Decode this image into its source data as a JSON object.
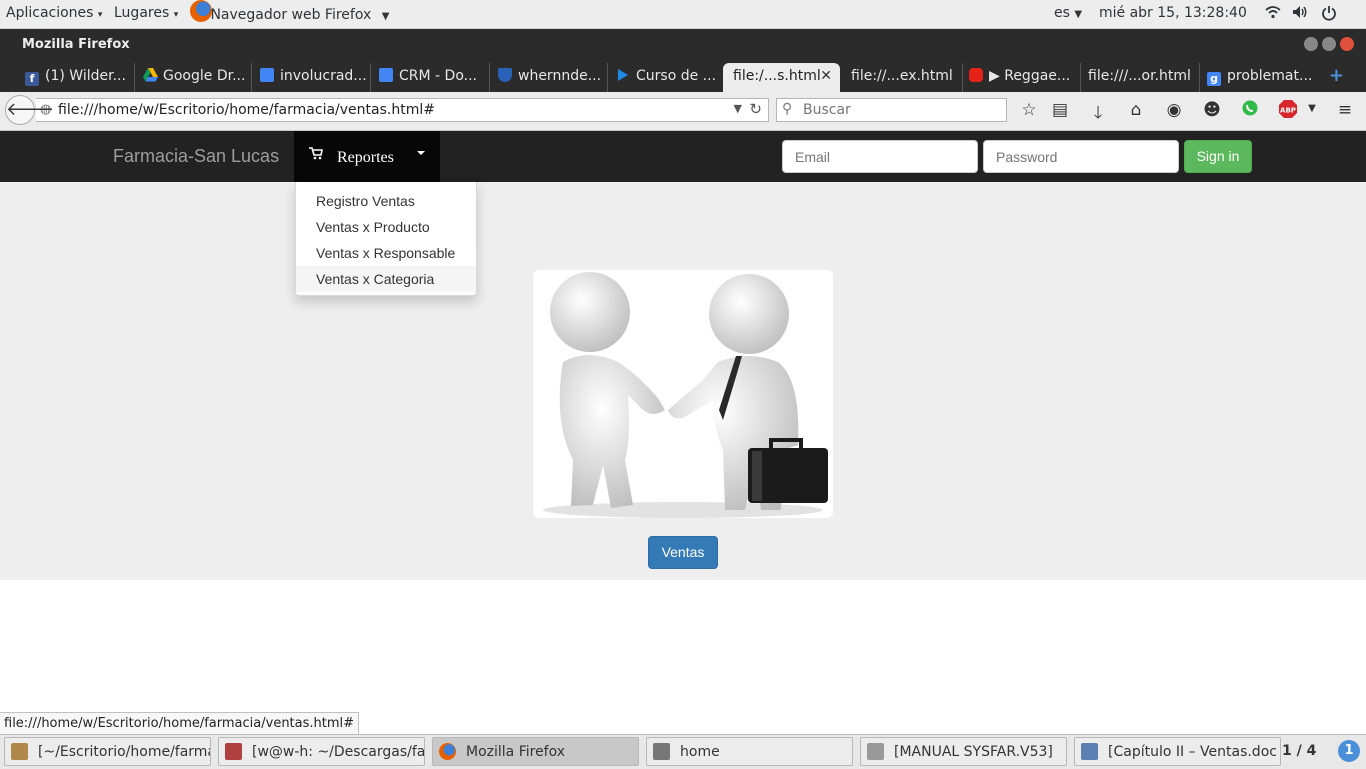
{
  "top_panel": {
    "apps_menu": "Aplicaciones",
    "places_menu": "Lugares",
    "active_app": "Navegador web Firefox",
    "language": "es",
    "clock": "mié abr 15, 13:28:40"
  },
  "window": {
    "title": "Mozilla Firefox"
  },
  "tabs": [
    {
      "label": "(1) Wilder...",
      "icon": "facebook-icon",
      "color": "#3b5998"
    },
    {
      "label": "Google Dr...",
      "icon": "google-drive-icon",
      "color": "#f4b400"
    },
    {
      "label": "involucrad...",
      "icon": "google-docs-icon",
      "color": "#4285f4"
    },
    {
      "label": "CRM - Do...",
      "icon": "google-docs-icon",
      "color": "#4285f4"
    },
    {
      "label": "whernnde...",
      "icon": "shield-icon",
      "color": "#2a62b8"
    },
    {
      "label": "Curso de ...",
      "icon": "bookmark-icon",
      "color": "#1e88e5"
    },
    {
      "label": "file:/...s.html",
      "icon": "none",
      "active": true
    },
    {
      "label": "file://...ex.html",
      "icon": "none"
    },
    {
      "label": "▶ Reggae...",
      "icon": "youtube-icon",
      "color": "#e62117"
    },
    {
      "label": "file:///...or.html",
      "icon": "none"
    },
    {
      "label": "problemat...",
      "icon": "google-icon",
      "color": "#4285f4"
    }
  ],
  "navbar": {
    "url": "file:///home/w/Escritorio/home/farmacia/ventas.html#",
    "search_placeholder": "Buscar"
  },
  "site": {
    "brand": "Farmacia-San Lucas",
    "reportes_label": "Reportes",
    "email_placeholder": "Email",
    "password_placeholder": "Password",
    "signin_label": "Sign in",
    "dropdown_items": [
      "Registro Ventas",
      "Ventas x Producto",
      "Ventas x Responsable",
      "Ventas x Categoria"
    ],
    "ventas_button": "Ventas",
    "primary_color": "#337ab7",
    "success_color": "#5cb85c"
  },
  "status_url": "file:///home/w/Escritorio/home/farmacia/ventas.html#",
  "taskbar": {
    "tasks": [
      {
        "label": "[~/Escritorio/home/farma...",
        "color": "#b0884a"
      },
      {
        "label": "[w@w-h: ~/Descargas/far...",
        "color": "#b04040"
      },
      {
        "label": "Mozilla Firefox",
        "color": "#e66000",
        "active": true
      },
      {
        "label": "home",
        "color": "#777777"
      },
      {
        "label": "[MANUAL SYSFAR.V53]",
        "color": "#999999"
      },
      {
        "label": "[Capítulo II – Ventas.doc ...",
        "color": "#5a7fb0"
      }
    ],
    "pager": "1 / 4",
    "notifications": "1"
  }
}
